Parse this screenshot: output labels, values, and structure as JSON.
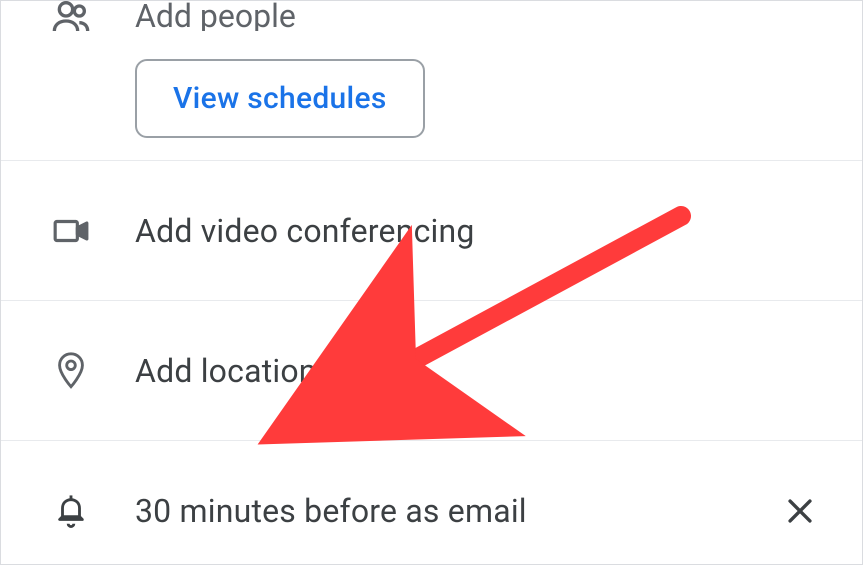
{
  "people": {
    "add_label": "Add people",
    "view_schedules_label": "View schedules"
  },
  "video": {
    "label": "Add video conferencing"
  },
  "location": {
    "label": "Add location"
  },
  "notification": {
    "label": "30 minutes before as email"
  }
}
